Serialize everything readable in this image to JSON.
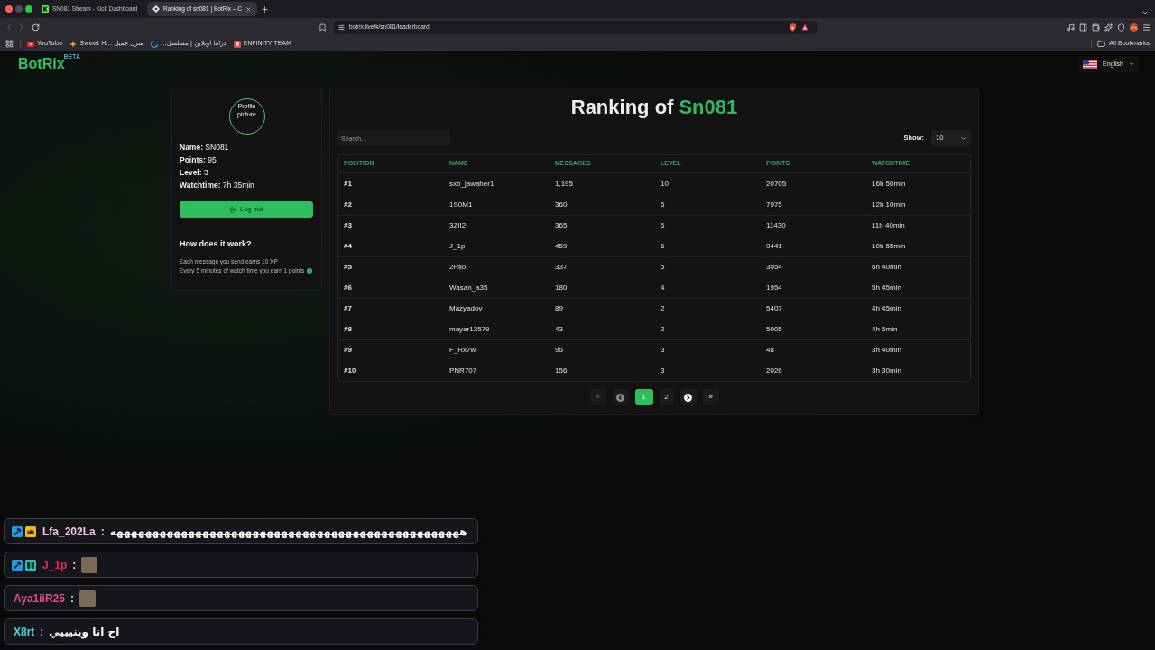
{
  "browser": {
    "tabs": [
      {
        "title": "SN081 Stream - Kick Dashboard",
        "selected": false
      },
      {
        "title": "Ranking of sn081 | BotRix – C",
        "selected": true
      }
    ],
    "url": "botrix.live/k/sn081/leaderboard",
    "bookmarks": [
      "YouTube",
      "Sweet H... منزل جميل",
      "دراما اونلاين | مسلسل...",
      "ENFINITY TEAM"
    ],
    "all_bookmarks": "All Bookmarks"
  },
  "header": {
    "logo": "BotRix",
    "badge": "BETA",
    "language": "English"
  },
  "profile": {
    "picture_alt": "Profile picture",
    "details": [
      "**Name:** SN081",
      "**Points:** 95",
      "**Level:** 3",
      "**Watchtime:** 7h 35min"
    ],
    "logout": "Log out",
    "help_title": "How does it work?",
    "help_lines": [
      "Each message you send earns 10 XP",
      "Every 5 minutes of watch time you earn 1 points"
    ]
  },
  "leaderboard": {
    "title": "Ranking of",
    "channel": "Sn081",
    "search": {
      "placeholder": "Search..."
    },
    "show_label": "Show:",
    "show_value": "10",
    "columns": [
      "POSITION",
      "NAME",
      "MESSAGES",
      "LEVEL",
      "POINTS",
      "WATCHTIME"
    ],
    "rows": [
      [
        "#1",
        "sxb_jawaher1",
        "1,195",
        "10",
        "20705",
        "16h 50min"
      ],
      [
        "#2",
        "1S0M1",
        "360",
        "6",
        "7975",
        "12h 10min"
      ],
      [
        "#3",
        "3ZII2",
        "365",
        "6",
        "11430",
        "11h 40min"
      ],
      [
        "#4",
        "J_1p",
        "459",
        "6",
        "9441",
        "10h 55min"
      ],
      [
        "#5",
        "2Riio",
        "337",
        "5",
        "3054",
        "6h 40min"
      ],
      [
        "#6",
        "Wasan_a35",
        "180",
        "4",
        "1954",
        "5h 45min"
      ],
      [
        "#7",
        "Mazyadov",
        "89",
        "2",
        "5407",
        "4h 45min"
      ],
      [
        "#8",
        "mayar13579",
        "43",
        "2",
        "5005",
        "4h 5min"
      ],
      [
        "#9",
        "F_Rx7w",
        "95",
        "3",
        "48",
        "3h 40min"
      ],
      [
        "#10",
        "PNR707",
        "156",
        "3",
        "2026",
        "3h 30min"
      ]
    ],
    "pagination": {
      "first": {
        "label": "«",
        "disabled": true
      },
      "prev": {
        "disabled": true
      },
      "pages": [
        {
          "label": "1",
          "selected": true
        },
        {
          "label": "2",
          "selected": false
        }
      ],
      "next": {
        "disabled": false
      },
      "last": {
        "label": "»",
        "disabled": false
      }
    }
  },
  "chat": [
    {
      "user": "Lfa_202La",
      "color": "#f5c6dc",
      "badges": [
        {
          "kind": "moderator"
        },
        {
          "kind": "crown"
        }
      ],
      "separator": ":",
      "message": {
        "kind": "text",
        "text": "هههههههههههههههههههههههههههههههههههههههههههههههههه"
      }
    },
    {
      "user": "J_1p",
      "color": "#e8295f",
      "badges": [
        {
          "kind": "moderator"
        },
        {
          "kind": "og"
        }
      ],
      "separator": ":",
      "message": {
        "kind": "emote"
      }
    },
    {
      "user": "Aya1iiR25",
      "color": "#e34aa0",
      "separator": ":",
      "message": {
        "kind": "emote"
      }
    },
    {
      "user": "X8rt",
      "color": "#36e0cf",
      "separator": ":",
      "message": {
        "kind": "text",
        "text": "اح انا وينيييي"
      }
    }
  ]
}
